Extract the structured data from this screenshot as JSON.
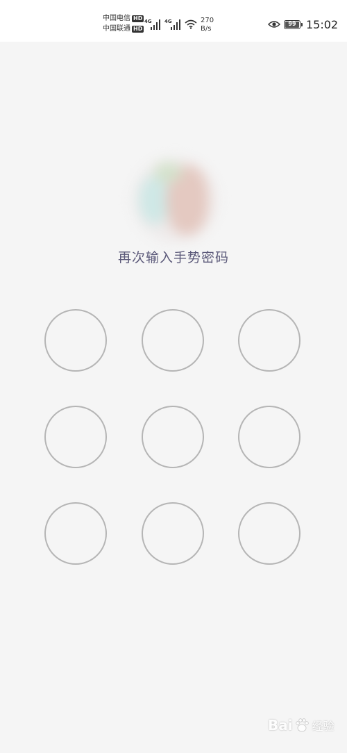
{
  "status_bar": {
    "carrier_1": "中国电信",
    "carrier_1_badge": "HD",
    "carrier_2": "中国联通",
    "carrier_2_badge": "HD",
    "signal_1_type": "4G",
    "signal_2_type": "4G",
    "net_speed_value": "270",
    "net_speed_unit": "B/s",
    "battery_level": "99",
    "time": "15:02"
  },
  "lock_screen": {
    "prompt": "再次输入手势密码",
    "dots": [
      1,
      2,
      3,
      4,
      5,
      6,
      7,
      8,
      9
    ]
  },
  "watermark": {
    "brand_left": "Bai",
    "brand_right": "经验"
  },
  "colors": {
    "background": "#f5f5f5",
    "status_bar": "#ffffff",
    "prompt_text": "#5c5a7a",
    "dot_border": "#b5b5b5"
  },
  "icons": {
    "signal": "signal-bars-icon",
    "wifi": "wifi-icon",
    "eye": "eye-icon",
    "battery": "battery-icon",
    "watermark": "baidu-paw-icon"
  }
}
